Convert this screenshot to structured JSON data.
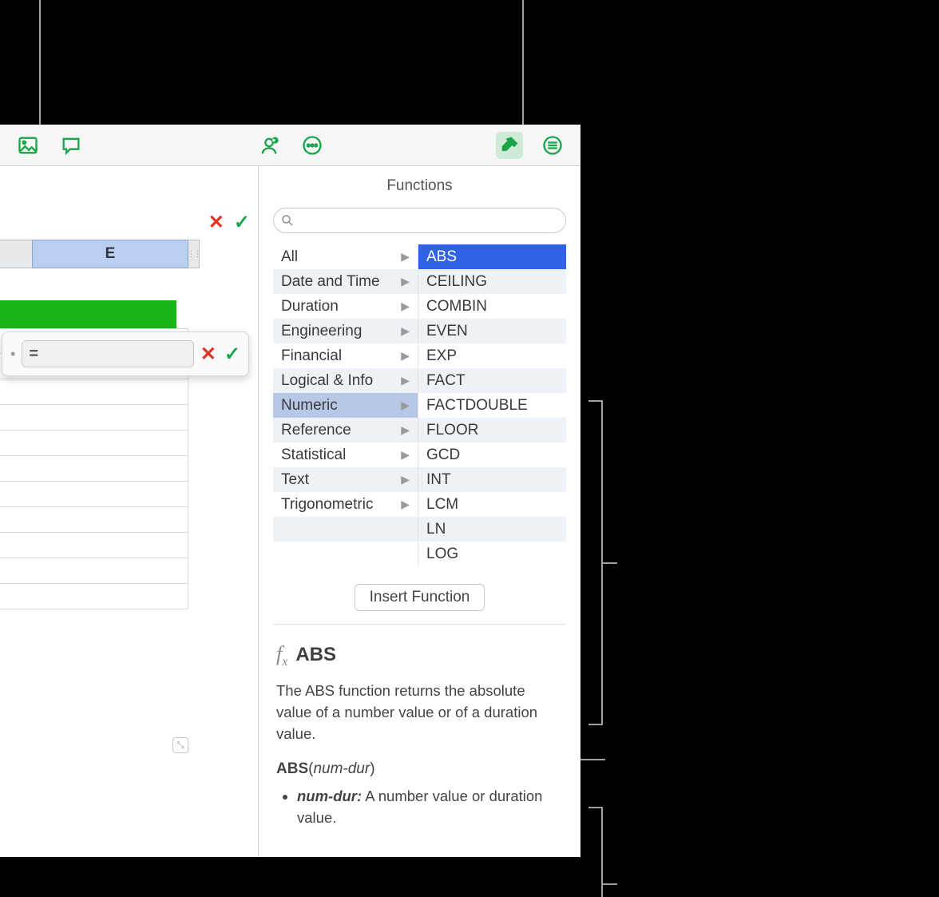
{
  "sidebar": {
    "title": "Functions",
    "search_placeholder": "",
    "insert_label": "Insert Function"
  },
  "sheet": {
    "column_label": "E",
    "formula_value": "="
  },
  "categories": [
    {
      "label": "All",
      "selected": false
    },
    {
      "label": "Date and Time",
      "selected": false
    },
    {
      "label": "Duration",
      "selected": false
    },
    {
      "label": "Engineering",
      "selected": false
    },
    {
      "label": "Financial",
      "selected": false
    },
    {
      "label": "Logical & Info",
      "selected": false
    },
    {
      "label": "Numeric",
      "selected": true
    },
    {
      "label": "Reference",
      "selected": false
    },
    {
      "label": "Statistical",
      "selected": false
    },
    {
      "label": "Text",
      "selected": false
    },
    {
      "label": "Trigonometric",
      "selected": false
    },
    {
      "label": "",
      "selected": false
    },
    {
      "label": "",
      "selected": false
    }
  ],
  "functions": [
    {
      "label": "ABS",
      "selected": true
    },
    {
      "label": "CEILING",
      "selected": false
    },
    {
      "label": "COMBIN",
      "selected": false
    },
    {
      "label": "EVEN",
      "selected": false
    },
    {
      "label": "EXP",
      "selected": false
    },
    {
      "label": "FACT",
      "selected": false
    },
    {
      "label": "FACTDOUBLE",
      "selected": false
    },
    {
      "label": "FLOOR",
      "selected": false
    },
    {
      "label": "GCD",
      "selected": false
    },
    {
      "label": "INT",
      "selected": false
    },
    {
      "label": "LCM",
      "selected": false
    },
    {
      "label": "LN",
      "selected": false
    },
    {
      "label": "LOG",
      "selected": false
    }
  ],
  "help": {
    "name": "ABS",
    "description": "The ABS function returns the absolute value of a number value or of a duration value.",
    "signature_name": "ABS",
    "signature_arg": "num-dur",
    "arg_name": "num-dur:",
    "arg_desc": " A number value or duration value."
  },
  "x_glyph": "✕",
  "check_glyph": "✓"
}
